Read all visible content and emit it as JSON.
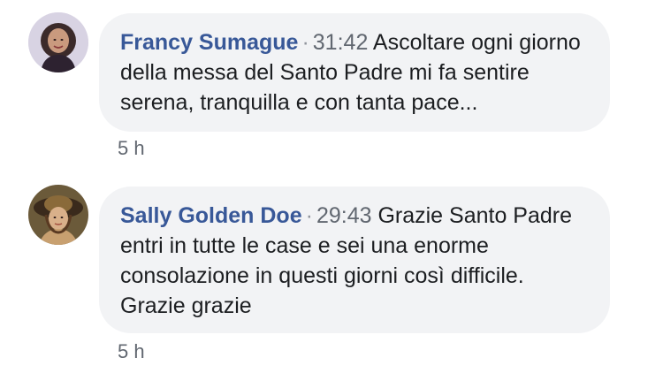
{
  "comments": [
    {
      "author": "Francy Sumague",
      "separator": "·",
      "timestamp": "31:42",
      "text": "Ascoltare ogni giorno della messa del Santo Padre mi fa sentire serena, tranquilla e con tanta pace...",
      "age": "5 h"
    },
    {
      "author": "Sally Golden Doe",
      "separator": "·",
      "timestamp": "29:43",
      "text": "Grazie Santo Padre entri in tutte le case e sei una enorme consolazione in questi giorni così difficile. Grazie grazie",
      "age": "5 h"
    }
  ],
  "colors": {
    "bubble": "#f2f3f5",
    "author": "#385898",
    "meta": "#616770"
  }
}
